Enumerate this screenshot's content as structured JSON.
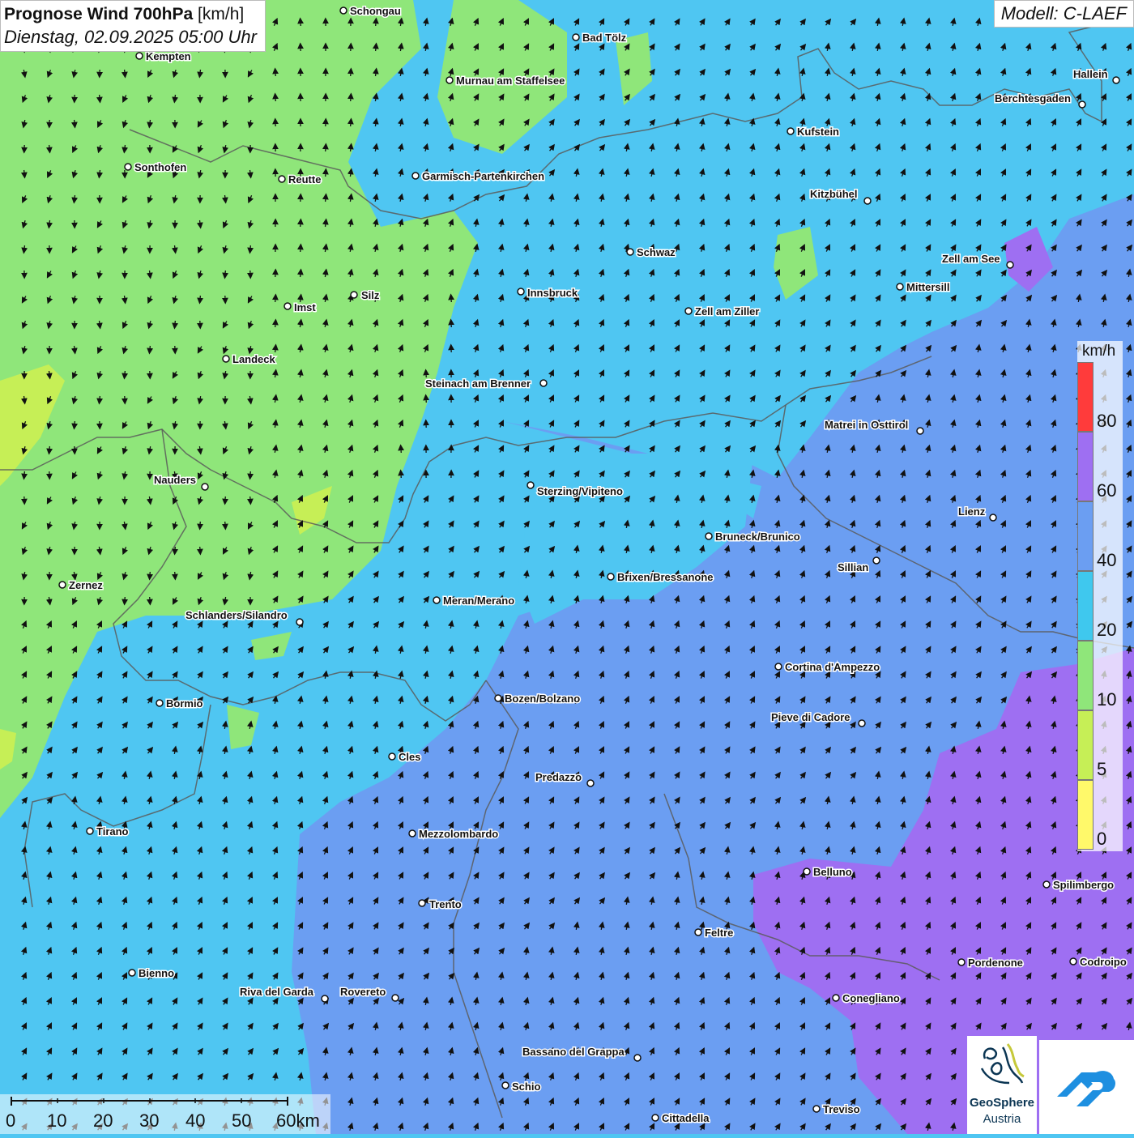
{
  "title": {
    "main_bold": "Prognose Wind 700hPa",
    "main_unit": "[km/h]",
    "date": "Dienstag, 02.09.2025 05:00 Uhr"
  },
  "model": "Modell: C-LAEF",
  "legend": {
    "unit": "km/h",
    "ticks": [
      "80",
      "60",
      "40",
      "20",
      "10",
      "5",
      "0"
    ],
    "colors": [
      "#ff3b3b",
      "#9e6ff2",
      "#6b9ef2",
      "#3fc8ee",
      "#8fe67a",
      "#c6ef56",
      "#fff96a"
    ]
  },
  "scale": {
    "labels": [
      "0",
      "10",
      "20",
      "30",
      "40",
      "50",
      "60km"
    ]
  },
  "logos": {
    "geosphere_line1": "GeoSphere",
    "geosphere_line2": "Austria"
  },
  "cities": [
    "Schongau",
    "Bad Tölz",
    "Kempten",
    "Murnau am Staffelsee",
    "Hallein",
    "Berchtesgaden",
    "Kufstein",
    "Sonthofen",
    "Reutte",
    "Garmisch-Partenkirchen",
    "Kitzbühel",
    "Schwaz",
    "Zell am See",
    "Mittersill",
    "Innsbruck",
    "Silz",
    "Imst",
    "Zell am Ziller",
    "Landeck",
    "Steinach am Brenner",
    "Matrei in Osttirol",
    "Nauders",
    "Sterzing/Vipiteno",
    "Lienz",
    "Bruneck/Brunico",
    "Sillian",
    "Zernez",
    "Brixen/Bressanone",
    "Meran/Merano",
    "Schlanders/Silandro",
    "Cortina d'Ampezzo",
    "Bormio",
    "Bozen/Bolzano",
    "Pieve di Cadore",
    "Cles",
    "Predazzo",
    "Tirano",
    "Mezzolombardo",
    "Belluno",
    "Spilimbergo",
    "Trento",
    "Feltre",
    "Bienno",
    "Pordenone",
    "Codroipo",
    "Riva del Garda",
    "Rovereto",
    "Conegliano",
    "Bassano del Grappa",
    "Schio",
    "Treviso",
    "Cittadella"
  ]
}
